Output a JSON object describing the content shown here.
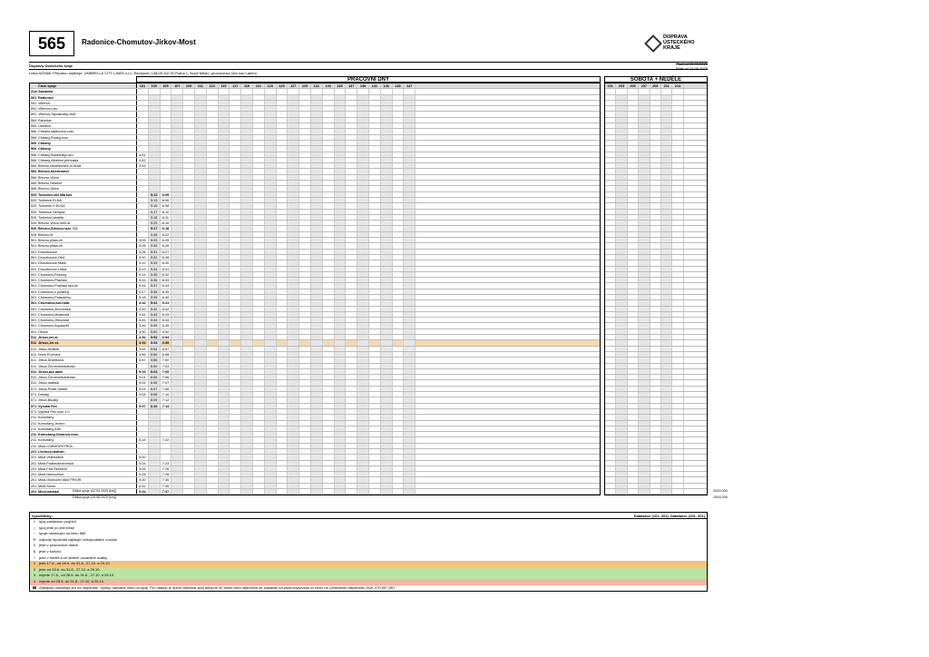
{
  "header": {
    "route_number": "565",
    "route_name": "Radonice-Chomutov-Jirkov-Most",
    "logo_text": "DOPRAVA\nÚSTECKÉHO\nKRAJE",
    "orderer": "Dopravu Ústeckého kraje",
    "valid_old": "Platí od 02.03.2025",
    "valid_new": "Platí od 15.06.2025",
    "carrier": "Linka 522565: Přepravu zajišťuje: UMBRELLA CITY LINES s.r.o.,Revoluční 1082/8,110 00 Praha 1, Nové Město, provozovna Ústí nad Labem"
  },
  "sections": {
    "weekday": "PRACOVNÍ DNY",
    "weekend": "SOBOTA + NEDĚLE"
  },
  "table_head": {
    "trip_label": "Číslo spoje",
    "zone_label": "Zóna",
    "stop_label": "Zastávka"
  },
  "trips_weekday": [
    "101",
    "103",
    "105",
    "107",
    "109",
    "111",
    "113",
    "115",
    "117",
    "119",
    "121",
    "123",
    "125",
    "127",
    "129",
    "131",
    "133",
    "135",
    "137",
    "139",
    "141",
    "143",
    "145",
    "147"
  ],
  "trips_weekend": [
    "201",
    "203",
    "205",
    "207",
    "209",
    "211",
    "213"
  ],
  "stops": [
    {
      "z": "591",
      "n": "Radonice",
      "b": true
    },
    {
      "z": "591",
      "n": "Vilémov",
      "b": false
    },
    {
      "z": "591",
      "n": "Vilémov,rozc.",
      "b": false
    },
    {
      "z": "591",
      "n": "Vilémov,Topolanský dvůr",
      "b": false
    },
    {
      "z": "564",
      "n": "Račetice",
      "b": false
    },
    {
      "z": "565",
      "n": "Libědice",
      "b": false
    },
    {
      "z": "566",
      "n": "Chbany,Vadkovice,rozc.",
      "b": false
    },
    {
      "z": "566",
      "n": "Chbany,Poláky,rozc.",
      "b": false
    },
    {
      "z": "566",
      "n": "Chbany",
      "b": true
    },
    {
      "z": "566",
      "n": "Chbany",
      "b": true
    },
    {
      "z": "566",
      "n": "Chbany,Soběsuky,rozc.",
      "b": false
    },
    {
      "z": "566",
      "n": "Chbany,Vikletice,přehrada",
      "b": false
    },
    {
      "z": "566",
      "n": "Březno,Neutraunice,ru.most.",
      "b": false
    },
    {
      "z": "566",
      "n": "Březno,Nechranice",
      "b": true
    },
    {
      "z": "566",
      "n": "Březno,Vičice",
      "b": false
    },
    {
      "z": "566",
      "n": "Březno,Stranné",
      "b": false
    },
    {
      "z": "566",
      "n": "Březno,Vičice",
      "b": false
    },
    {
      "z": "533",
      "n": "Tušimice,důl Markus",
      "b": true
    },
    {
      "z": "533",
      "n": "Tušimice,ELNA",
      "b": false
    },
    {
      "z": "533",
      "n": "Tušimice,X ELNA",
      "b": false
    },
    {
      "z": "533",
      "n": "Tušimice,Sempra",
      "b": false
    },
    {
      "z": "533",
      "n": "Tušimice,lokalita",
      "b": false
    },
    {
      "z": "526",
      "n": "Březno,Vičice,elek.st.",
      "b": false
    },
    {
      "z": "526",
      "n": "Březno,Střezov,rozc. 0.2",
      "b": true
    },
    {
      "z": "526",
      "n": "Březno,rtl",
      "b": false
    },
    {
      "z": "501",
      "n": "Březno,pilaw.ořl",
      "b": false
    },
    {
      "z": "501",
      "n": "Březno,pilaw.ořl",
      "b": false
    },
    {
      "z": "501",
      "n": "Droužkovice",
      "b": false
    },
    {
      "z": "501",
      "n": "Droužkovice,OkÚ",
      "b": false
    },
    {
      "z": "501",
      "n": "Droužkovice,Málik",
      "b": false
    },
    {
      "z": "501",
      "n": "Droužkovice,Letka",
      "b": false
    },
    {
      "z": "501",
      "n": "Chomutov,Rosický",
      "b": false
    },
    {
      "z": "501",
      "n": "Chomutov,Pražská",
      "b": false
    },
    {
      "z": "501",
      "n": "Chomutov,Pražská škol.st.",
      "b": false
    },
    {
      "z": "501",
      "n": "Chomutov,v polabny",
      "b": false
    },
    {
      "z": "501",
      "n": "Chomutov,Palackého",
      "b": false
    },
    {
      "z": "501",
      "n": "Chomutov,aut.nádr.",
      "b": true
    },
    {
      "z": "501",
      "n": "Chomutov,Zborovská",
      "b": false
    },
    {
      "z": "501",
      "n": "Chomutov,Mostecká",
      "b": false
    },
    {
      "z": "501",
      "n": "Chomutov,Jirkovská",
      "b": false
    },
    {
      "z": "501",
      "n": "Chomutov,Aquasvět",
      "b": false
    },
    {
      "z": "501",
      "n": "Otvice",
      "b": false
    },
    {
      "z": "511",
      "n": "Jirkov,žel.st.",
      "b": true
    },
    {
      "z": "511",
      "n": "Jirkov,Jer.st.",
      "b": true
    },
    {
      "z": "511",
      "n": "Jirkov,Hrabné",
      "b": false
    },
    {
      "z": "511",
      "n": "Nové Ervěnice",
      "b": false
    },
    {
      "z": "511",
      "n": "Jirkov,Drahtkova",
      "b": false
    },
    {
      "z": "511",
      "n": "Jirkov,Červenohrádecká",
      "b": false
    },
    {
      "z": "511",
      "n": "Jirkov,aut.nádr.",
      "b": true
    },
    {
      "z": "511",
      "n": "Jirkov,Červenohrádecká",
      "b": false
    },
    {
      "z": "511",
      "n": "Jirkov,nádraží",
      "b": false
    },
    {
      "z": "571",
      "n": "Jirkov,Podle drahtů",
      "b": false
    },
    {
      "z": "571",
      "n": "Drmaly",
      "b": false
    },
    {
      "z": "571",
      "n": "Jirkov,Boulky",
      "b": false
    },
    {
      "z": "571",
      "n": "Vysoká Pec",
      "b": true
    },
    {
      "z": "571",
      "n": "Vysoká Pec,rozc.1.0",
      "b": false
    },
    {
      "z": "211",
      "n": "Komořany",
      "b": false
    },
    {
      "z": "211",
      "n": "Komořany,Jezero",
      "b": false
    },
    {
      "z": "211",
      "n": "Komořany,ASK",
      "b": false
    },
    {
      "z": "211",
      "n": "Komořany,Obránců míru",
      "b": true
    },
    {
      "z": "211",
      "n": "Komořany",
      "b": false
    },
    {
      "z": "211",
      "n": "Most,CHEMOPETROL",
      "b": false
    },
    {
      "z": "221",
      "n": "Litvínov,nádraží",
      "b": true
    },
    {
      "z": "221",
      "n": "Most,Velebudice",
      "b": false
    },
    {
      "z": "201",
      "n": "Most,Podkrušnohorská",
      "b": false
    },
    {
      "z": "201",
      "n": "Most,Pod Resslem",
      "b": false
    },
    {
      "z": "201",
      "n": "Most,Nemocnice",
      "b": false
    },
    {
      "z": "201",
      "n": "Most,Obchodní dům PRIOR",
      "b": false
    },
    {
      "z": "201",
      "n": "Most,Sever",
      "b": false
    },
    {
      "z": "201",
      "n": "Most,nádraží",
      "b": true
    }
  ],
  "weekday_times": {
    "c0": [
      "",
      "",
      "",
      "",
      "",
      "",
      "",
      "",
      "",
      "",
      "4:51",
      "4:52",
      "4:53",
      "",
      "",
      "",
      "",
      "",
      "",
      "",
      "",
      "",
      "",
      "",
      "",
      "5:05",
      "5:05",
      "5:06",
      "5:10",
      "5:12",
      "5:13",
      "5:14",
      "5:15",
      "5:16",
      "5:17",
      "5:18",
      "4:42",
      "4:43",
      "4:44",
      "4:45",
      "4:46",
      "4:50",
      "4:52",
      "4:52",
      "4:54",
      "4:56",
      "4:57",
      "",
      "5:00",
      "5:01",
      "5:02",
      "5:03",
      "5:05",
      "",
      "5:07",
      "",
      "",
      "",
      "",
      "",
      "5:15",
      "",
      "",
      "5:20",
      "5:24",
      "5:26",
      "5:28",
      "5:30",
      "5:32",
      "5:34"
    ],
    "c1": [
      "",
      "",
      "",
      "",
      "",
      "",
      "",
      "",
      "",
      "",
      "",
      "",
      "",
      "",
      "",
      "",
      "",
      "5:12",
      "5:13",
      "5:15",
      "5:17",
      "5:18",
      "5:25",
      "5:27",
      "5:28",
      "5:29",
      "5:30",
      "5:31",
      "5:32",
      "5:33",
      "5:34",
      "5:35",
      "5:36",
      "5:37",
      "5:38",
      "5:39",
      "5:41",
      "5:42",
      "5:43",
      "5:44",
      "5:45",
      "5:50",
      "5:52",
      "5:53",
      "5:54",
      "5:56",
      "5:58",
      "6:00",
      "6:03",
      "6:05",
      "6:06",
      "6:07",
      "6:08",
      "6:09",
      "6:10",
      "",
      "",
      "",
      "",
      "",
      "",
      "",
      "",
      "",
      "",
      "",
      "",
      "",
      "",
      ""
    ],
    "c2": [
      "",
      "",
      "",
      "",
      "",
      "",
      "",
      "",
      "",
      "",
      "",
      "",
      "",
      "",
      "",
      "",
      "",
      "6:05",
      "6:06",
      "6:08",
      "6:10",
      "6:11",
      "6:16",
      "6:18",
      "6:22",
      "6:25",
      "6:26",
      "6:27",
      "6:28",
      "6:30",
      "6:31",
      "6:32",
      "6:33",
      "6:34",
      "6:35",
      "6:40",
      "6:41",
      "6:42",
      "6:43",
      "6:44",
      "6:45",
      "6:52",
      "6:54",
      "6:55",
      "6:57",
      "6:58",
      "7:00",
      "7:03",
      "7:05",
      "7:06",
      "7:07",
      "7:08",
      "7:10",
      "7:12",
      "7:14",
      "",
      "",
      "",
      "",
      "",
      "7:22",
      "",
      "",
      "",
      "7:23",
      "7:26",
      "7:28",
      "7:30",
      "7:35",
      "7:37"
    ]
  },
  "footer": {
    "km_old": "Délka spoje (02.03.2025 [km])",
    "km_new": "Délka spoje (15.06.2025 [km])",
    "km_total_1": "1043,000",
    "km_total_2": "1043,000"
  },
  "legend": {
    "title": "Vysvětlivky:",
    "right_note": "Dataláčce (101, 201), Dataláčce (101, 201)",
    "items": [
      {
        "sym": "†",
        "text": "spoj zastávkou projíždí",
        "cls": ""
      },
      {
        "sym": "|",
        "text": "spoj jede po jiné trase",
        "cls": ""
      },
      {
        "sym": "~",
        "text": "spoje navazující na linku 565",
        "cls": ""
      },
      {
        "sym": "R",
        "text": "odjezdy zpravidla zajištuje nízkopodlažní vozidlo",
        "cls": ""
      },
      {
        "sym": "X",
        "text": "jede v pracovních dnech",
        "cls": ""
      },
      {
        "sym": "6",
        "text": "jede v sobotu",
        "cls": ""
      },
      {
        "sym": "+",
        "text": "jede v neděli a ve státem uznávané svátky",
        "cls": ""
      },
      {
        "sym": "1",
        "text": "jede 17.6., od 28.6. do 31.8., 27.10. a 29.10.",
        "cls": "orange"
      },
      {
        "sym": "2",
        "text": "jede od 28.6. do 31.8., 27.10. a 29.10.",
        "cls": "green"
      },
      {
        "sym": "3",
        "text": "nejede 17.6., od 28.6. do 31.8., 27.10. a 29.10.",
        "cls": "green"
      },
      {
        "sym": "4",
        "text": "nejede od 28.6. do 31.8., 27.10. a 29.10.",
        "cls": "pink"
      },
      {
        "sym": "☎",
        "text": "Zastávku obsluhuje jen na objednání. Výstup nahlaste řidiči na spoji. Pro nástup je nutné objednat spoj alespoň 60 minut před odjezdem ze zastávky na www.dopravauk.cz nebo na Centrálním dispečinku DUK 475 657 657.",
        "cls": ""
      }
    ]
  }
}
